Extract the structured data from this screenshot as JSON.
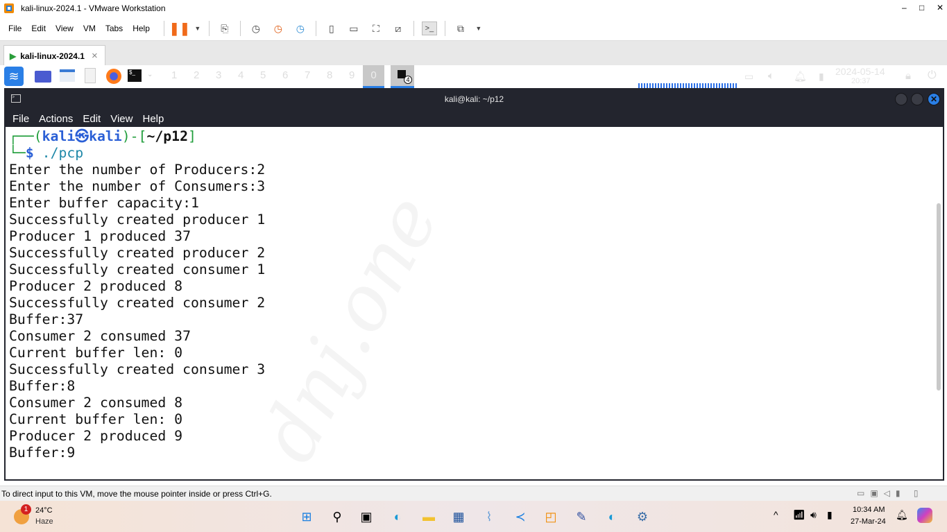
{
  "window": {
    "title": "kali-linux-2024.1 - VMware Workstation",
    "minimize": "–",
    "maximize": "□",
    "close": "✕"
  },
  "menu": [
    "File",
    "Edit",
    "View",
    "VM",
    "Tabs",
    "Help"
  ],
  "vm_tab": {
    "label": "kali-linux-2024.1",
    "close": "×"
  },
  "kali_panel": {
    "workspaces": [
      "1",
      "2",
      "3",
      "4",
      "5",
      "6",
      "7",
      "8",
      "9",
      "0"
    ],
    "terminal_badge": "4",
    "date": "2024-05-14",
    "time": "20:37"
  },
  "terminal": {
    "title": "kali@kali: ~/p12",
    "menu": [
      "File",
      "Actions",
      "Edit",
      "View",
      "Help"
    ],
    "prompt": {
      "user": "kali",
      "host": "kali",
      "dir": "~/p12",
      "command": "./pcp"
    },
    "output": [
      "Enter the number of Producers:2",
      "Enter the number of Consumers:3",
      "Enter buffer capacity:1",
      "Successfully created producer 1",
      "Producer 1 produced 37",
      "Successfully created producer 2",
      "Successfully created consumer 1",
      "Producer 2 produced 8",
      "Successfully created consumer 2",
      "Buffer:37",
      "Consumer 2 consumed 37",
      "Current buffer len: 0",
      "Successfully created consumer 3",
      "Buffer:8",
      "Consumer 2 consumed 8",
      "Current buffer len: 0",
      "Producer 2 produced 9",
      "Buffer:9"
    ],
    "watermark": "dnj.one"
  },
  "status_bar": {
    "text": "To direct input to this VM, move the mouse pointer inside or press Ctrl+G."
  },
  "taskbar": {
    "weather": {
      "temp": "24°C",
      "desc": "Haze",
      "badge": "1"
    },
    "time": "10:34 AM",
    "date": "27-Mar-24",
    "chevron": "^"
  }
}
